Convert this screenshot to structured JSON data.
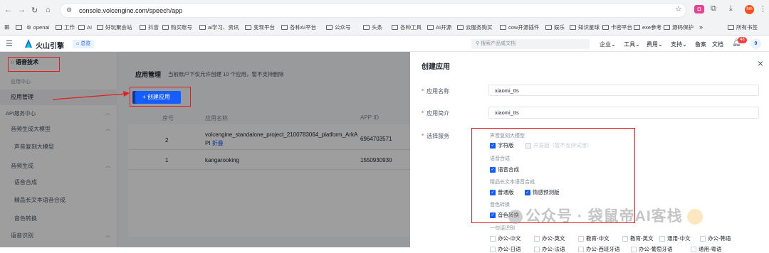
{
  "browser": {
    "url": "console.volcengine.com/speech/app",
    "bookmarks": [
      "openai",
      "工作",
      "AI",
      "好玩聚会站",
      "抖音",
      "购买账号",
      "ai学习、资讯",
      "变现平台",
      "各种AI平台",
      "公众号",
      "头条",
      "各种工具",
      "AI开源",
      "云服务购买",
      "cow开源插件",
      "娱乐",
      "知识星球",
      "卡密平台",
      "exe参考",
      "源码保护"
    ],
    "all_bookmarks": "所有书签",
    "more": "»",
    "profile": "hm"
  },
  "header": {
    "logo": "火山引擎",
    "home": "总览",
    "search_placeholder": "搜索产品或文档",
    "nav": [
      "企业",
      "工具",
      "费用",
      "支持"
    ],
    "beian": "备案",
    "docs": "文档",
    "notif_count": "48",
    "user": "9"
  },
  "sidebar": {
    "title": "语音技术",
    "app_center": "应用中心",
    "app_manage": "应用管理",
    "api_service": "API服务中心",
    "items": [
      {
        "label": "音频生成大模型",
        "chevron": true
      },
      {
        "label": "声音复刻大模型",
        "chevron": false
      },
      {
        "label": "音频生成",
        "chevron": true
      },
      {
        "label": "语音合成",
        "chevron": false
      },
      {
        "label": "精品长文本语音合成",
        "chevron": false
      },
      {
        "label": "音色转换",
        "chevron": false
      },
      {
        "label": "语音识别",
        "chevron": true
      }
    ]
  },
  "main": {
    "title": "应用管理",
    "subtitle": "当前账户下仅允许创建 10 个应用，暂不支持删除",
    "create_button": "创建应用",
    "columns": [
      "序号",
      "应用名称",
      "APP ID"
    ],
    "rows": [
      {
        "no": "2",
        "name": "volcengine_standalone_project_2100783064_platform_ArkA",
        "name2": "PI",
        "fold": "折叠",
        "appid": "6964703571"
      },
      {
        "no": "1",
        "name": "kangarooking",
        "name2": "",
        "fold": "",
        "appid": "1550930930"
      }
    ]
  },
  "panel": {
    "title": "创建应用",
    "close": "×",
    "name_label": "应用名称",
    "name_value": "xiaomi_tts",
    "desc_label": "应用简介",
    "desc_value": "xiaomi_tts",
    "service_label": "选择服务",
    "groups": [
      {
        "title": "声音复刻大模型",
        "options": [
          {
            "label": "字符版",
            "checked": true
          },
          {
            "label": "并发版（暂不支持试用）",
            "checked": false,
            "disabled": true
          }
        ]
      },
      {
        "title": "语音合成",
        "options": [
          {
            "label": "语音合成",
            "checked": true
          }
        ]
      },
      {
        "title": "精品长文本语音合成",
        "options": [
          {
            "label": "普通版",
            "checked": true
          },
          {
            "label": "情感预测版",
            "checked": true
          }
        ]
      },
      {
        "title": "音色转换",
        "options": [
          {
            "label": "音色转换",
            "checked": true
          }
        ]
      },
      {
        "title": "一句话识别",
        "options": [
          {
            "label": "办公-中文"
          },
          {
            "label": "办公-英文"
          },
          {
            "label": "教育-中文"
          },
          {
            "label": "教育-英文"
          },
          {
            "label": "通用-中文"
          },
          {
            "label": "办公-韩语"
          }
        ]
      },
      {
        "title": "",
        "options": [
          {
            "label": "办公-日语"
          },
          {
            "label": "办公-法语"
          },
          {
            "label": "办公-西班牙语"
          },
          {
            "label": "办公-葡萄牙语"
          },
          {
            "label": "通用-粤语"
          }
        ]
      }
    ]
  },
  "watermark": "公众号 · 袋鼠帝AI客栈",
  "colors": {
    "accent": "#165dff",
    "annotation": "#e02020"
  }
}
